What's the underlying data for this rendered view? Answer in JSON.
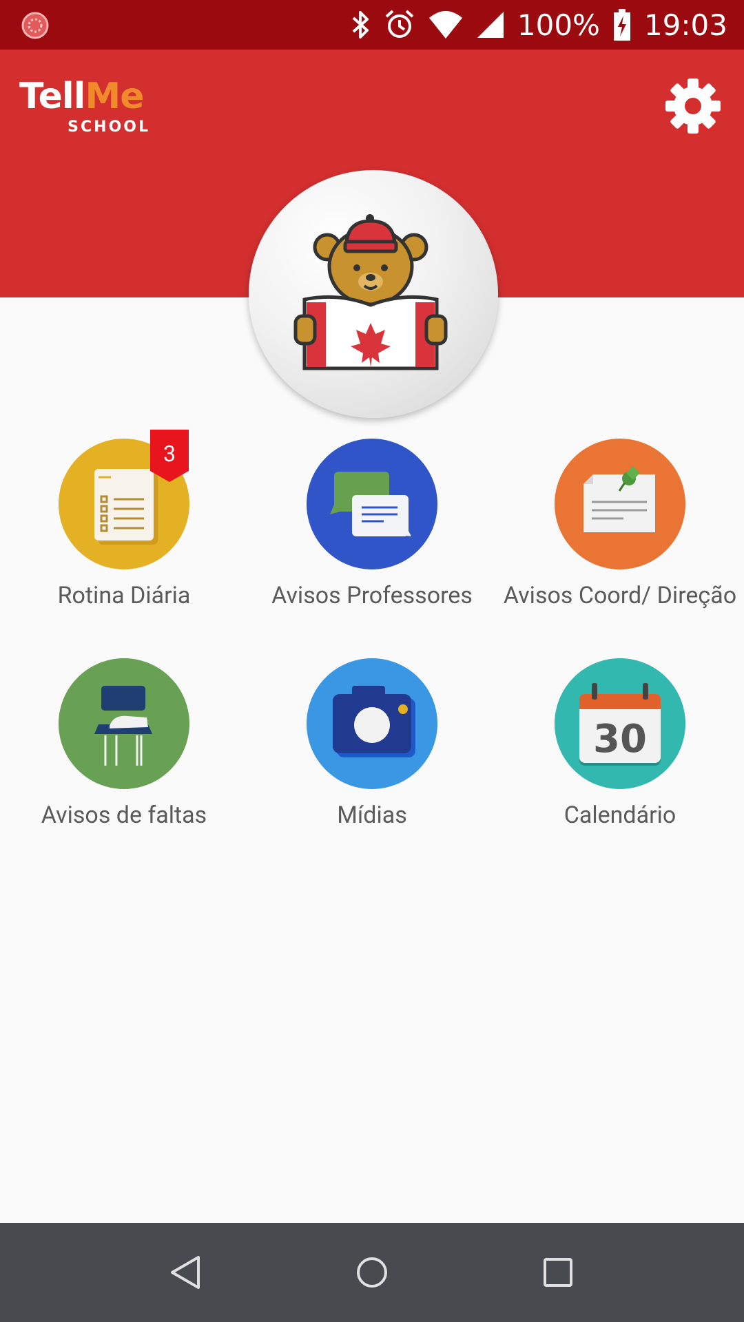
{
  "status_bar": {
    "battery": "100%",
    "time": "19:03"
  },
  "header": {
    "logo": {
      "tell": "Tell",
      "me": "Me",
      "school": "SCHOOL"
    }
  },
  "menu": [
    {
      "label": "Rotina Diária",
      "badge": "3",
      "color": "#e5b124"
    },
    {
      "label": "Avisos Professores",
      "color": "#2f55c8"
    },
    {
      "label": "Avisos Coord/ Direção",
      "color": "#e97433"
    },
    {
      "label": "Avisos de faltas",
      "color": "#68a153"
    },
    {
      "label": "Mídias",
      "color": "#3a97e3"
    },
    {
      "label": "Calendário",
      "color": "#33b8b0"
    }
  ],
  "calendar_day": "30",
  "colors": {
    "status_bar": "#9b0a0f",
    "header": "#d32f2f",
    "badge": "#e8141e",
    "nav_bar": "#474b50"
  }
}
